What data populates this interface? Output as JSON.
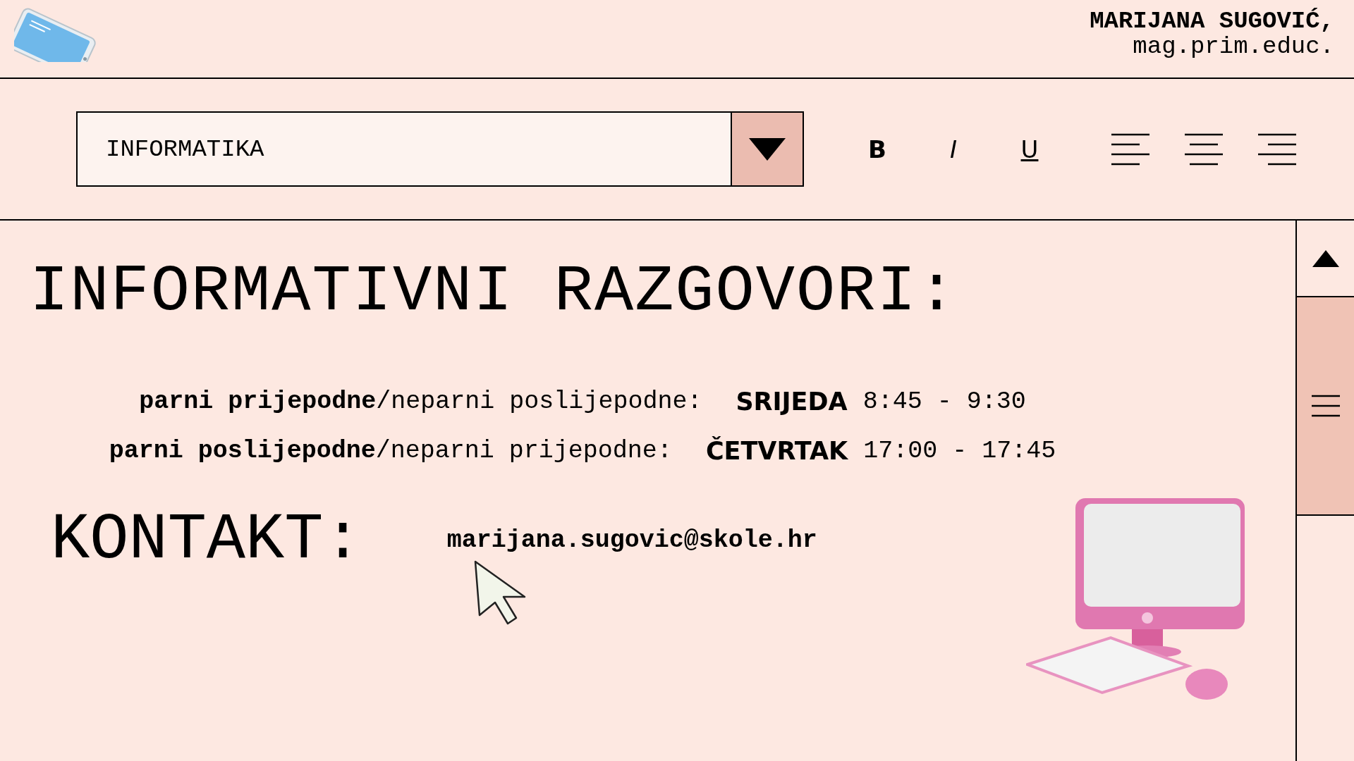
{
  "header": {
    "name": "MARIJANA SUGOVIĆ,",
    "title": "mag.prim.educ."
  },
  "toolbar": {
    "dropdown": {
      "value": "INFORMATIKA"
    },
    "format_buttons": [
      {
        "label": "B",
        "kind": "bold"
      },
      {
        "label": "I",
        "kind": "italic"
      },
      {
        "label": "U",
        "kind": "underline"
      }
    ],
    "align_buttons": [
      {
        "kind": "left"
      },
      {
        "kind": "center"
      },
      {
        "kind": "right"
      }
    ]
  },
  "heading": "INFORMATIVNI RAZGOVORI:",
  "schedule": [
    {
      "groups": "**parni prijepodne**/neparni poslijepodne:",
      "day": "SRIJEDA",
      "time": "8:45 - 9:30"
    },
    {
      "groups": "**parni poslijepodne**/neparni prijepodne:",
      "day": "ČETVRTAK",
      "time": "17:00 - 17:45"
    }
  ],
  "contact": {
    "label": "KONTAKT:",
    "email": "marijana.sugovic@skole.hr"
  }
}
